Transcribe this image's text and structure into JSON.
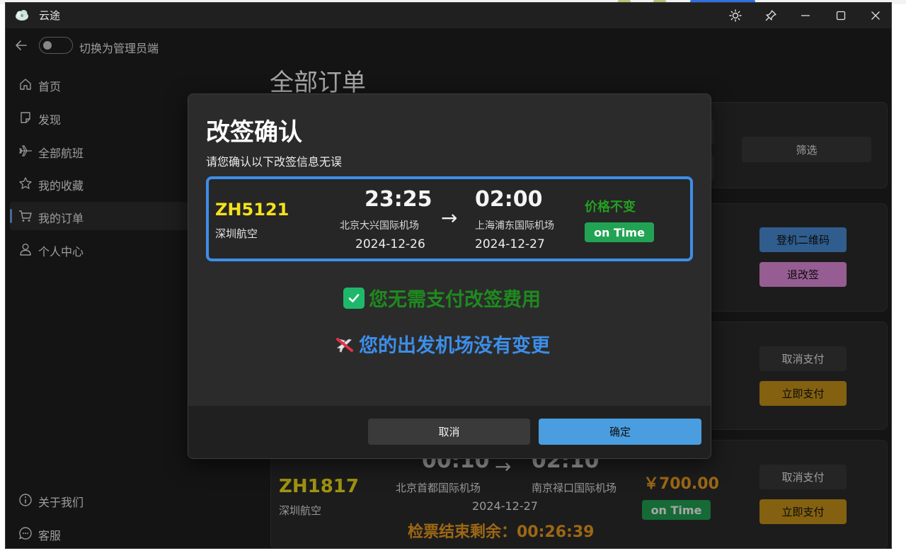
{
  "app": {
    "title": "云途",
    "logo_icon": "cloud-logo-icon"
  },
  "titlebar": {
    "icons": [
      "sun-icon",
      "pin-icon",
      "minimize-icon",
      "maximize-icon",
      "close-icon"
    ]
  },
  "topbar": {
    "back_icon": "arrow-left-icon",
    "toggle_label": "切换为管理员端",
    "toggle_on": false
  },
  "sidebar": {
    "items": [
      {
        "label": "首页",
        "icon": "home-icon",
        "active": false
      },
      {
        "label": "发现",
        "icon": "note-icon",
        "active": false
      },
      {
        "label": "全部航班",
        "icon": "airplane-icon",
        "active": false
      },
      {
        "label": "我的收藏",
        "icon": "star-icon",
        "active": false
      },
      {
        "label": "我的订单",
        "icon": "cart-icon",
        "active": true
      },
      {
        "label": "个人中心",
        "icon": "person-icon",
        "active": false
      }
    ],
    "bottom_items": [
      {
        "label": "关于我们",
        "icon": "info-icon"
      },
      {
        "label": "客服",
        "icon": "chat-icon"
      }
    ]
  },
  "page": {
    "title": "全部订单"
  },
  "filter_card": {
    "filter_button": "筛选"
  },
  "order_cards": [
    {
      "btn1": "登机二维码",
      "btn2": "退改签"
    },
    {
      "btn1": "取消支付",
      "btn2": "立即支付"
    },
    {
      "flight_no": "ZH1817",
      "airline": "深圳航空",
      "dep_time": "00:10",
      "arr_time": "02:10",
      "dep_airport": "北京首都国际机场",
      "arr_airport": "南京禄口国际机场",
      "date": "2024-12-27",
      "price": "￥700.00",
      "status": "on Time",
      "countdown": "检票结束剩余：00:26:39",
      "btn1": "取消支付",
      "btn2": "立即支付"
    }
  ],
  "dialog": {
    "title": "改签确认",
    "subtitle": "请您确认以下改签信息无误",
    "flight": {
      "flight_no": "ZH5121",
      "airline": "深圳航空",
      "dep_time": "23:25",
      "arr_time": "02:00",
      "dep_airport": "北京大兴国际机场",
      "arr_airport": "上海浦东国际机场",
      "dep_date": "2024-12-26",
      "arr_date": "2024-12-27",
      "arrow": "→",
      "price_note": "价格不变",
      "status": "on Time"
    },
    "message_fee": "您无需支付改签费用",
    "message_fee_icon": "check-box-icon",
    "message_airport": "您的出发机场没有变更",
    "message_airport_icon": "no-flight-icon",
    "cancel_label": "取消",
    "confirm_label": "确定"
  },
  "colors": {
    "accent": "#4a90d9",
    "flight_no": "#f5e21a",
    "price": "#f0a020",
    "on_time": "#22a354",
    "refund_button": "#e68fe0",
    "pay_button": "#c9961a",
    "message_green": "#1e8a1e",
    "message_blue": "#3d8ee8"
  }
}
